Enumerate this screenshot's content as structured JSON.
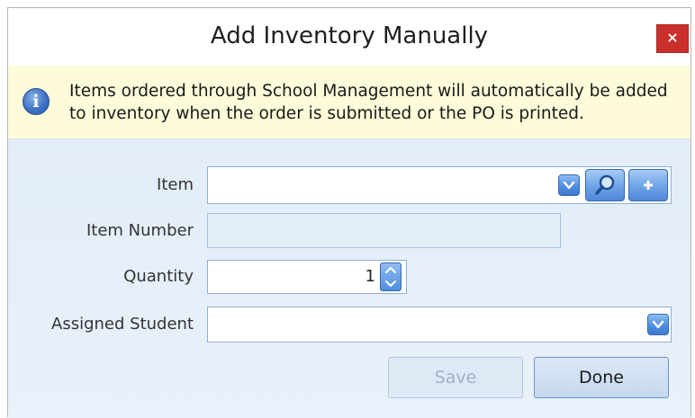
{
  "window": {
    "title": "Add Inventory Manually",
    "close_label": "×"
  },
  "info": {
    "icon": "info-icon",
    "line1": "Items ordered through School Management will automatically be added",
    "line2": "to inventory when the order is submitted or the PO is printed."
  },
  "form": {
    "item": {
      "label": "Item",
      "value": ""
    },
    "item_number": {
      "label": "Item Number",
      "value": ""
    },
    "quantity": {
      "label": "Quantity",
      "value": "1"
    },
    "assigned_student": {
      "label": "Assigned Student",
      "value": ""
    }
  },
  "buttons": {
    "save": "Save",
    "done": "Done"
  },
  "colors": {
    "accent": "#4f8ee0",
    "close": "#c9302c",
    "banner": "#fdfbd9",
    "form_bg": "#e6eff9"
  }
}
